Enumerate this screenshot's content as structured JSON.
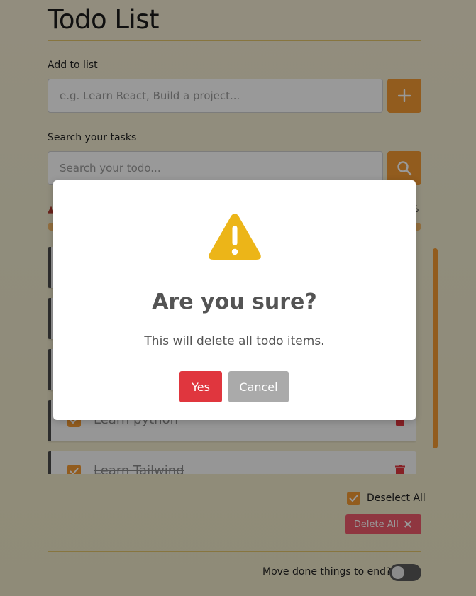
{
  "app": {
    "title": "Todo List"
  },
  "add": {
    "label": "Add to list",
    "placeholder": "e.g. Learn React, Build a project..."
  },
  "search": {
    "label": "Search your tasks",
    "placeholder": "Search your todo..."
  },
  "progress": {
    "percent_label_visible": "%"
  },
  "todos": [
    {
      "text": "Learn python",
      "done": true
    },
    {
      "text": "Learn Tailwind",
      "done": true
    }
  ],
  "bulk": {
    "deselect_label": "Deselect All",
    "delete_label": "Delete All",
    "delete_icon": "×"
  },
  "settings": {
    "move_done_label": "Move done things to end?",
    "move_done_enabled": false
  },
  "modal": {
    "icon": "warning-icon",
    "title": "Are you sure?",
    "text": "This will delete all todo items.",
    "confirm_label": "Yes",
    "cancel_label": "Cancel"
  },
  "colors": {
    "accent": "#f39a32",
    "danger": "#e0363e",
    "warning": "#ecb518"
  }
}
